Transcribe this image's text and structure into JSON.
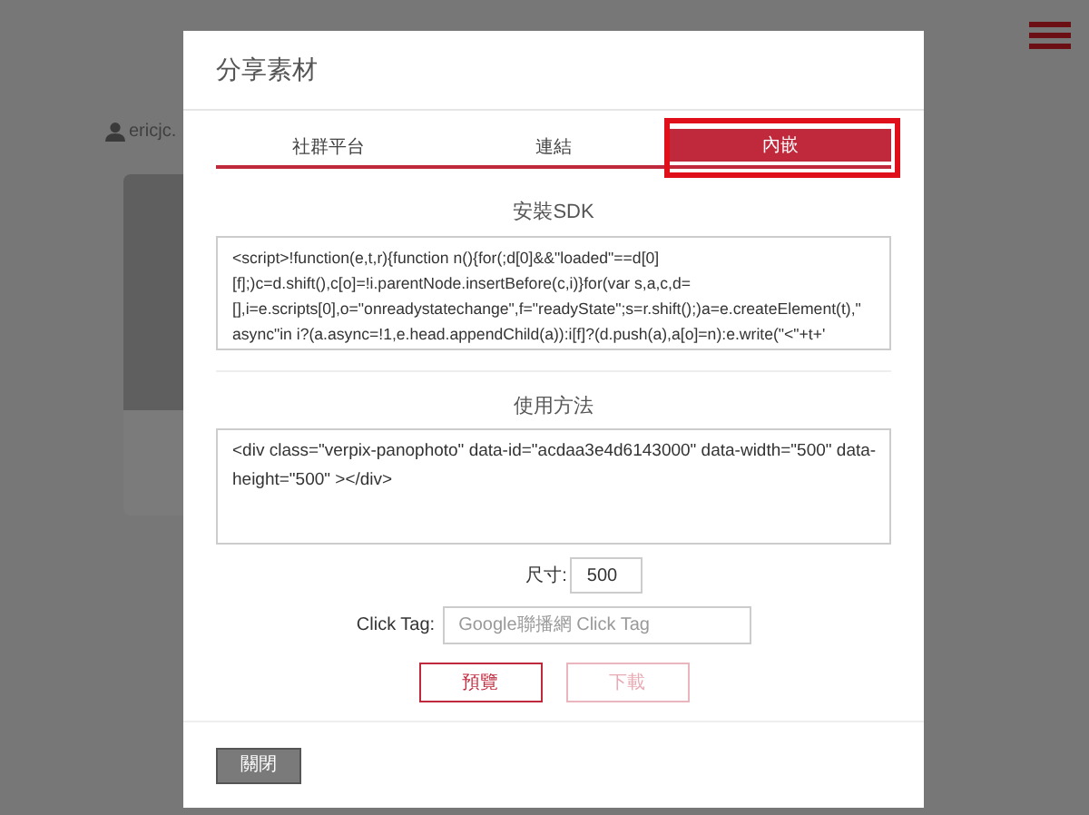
{
  "page": {
    "username": "ericjc."
  },
  "dialog": {
    "title": "分享素材",
    "tabs": [
      {
        "label": "社群平台",
        "selected": false
      },
      {
        "label": "連結",
        "selected": false
      },
      {
        "label": "內嵌",
        "selected": true
      }
    ],
    "sdk_section": {
      "heading": "安裝SDK",
      "code": "<script>!function(e,t,r){function n(){for(;d[0]&&\"loaded\"==d[0]\n[f];)c=d.shift(),c[o]=!i.parentNode.insertBefore(c,i)}for(var s,a,c,d=\n[],i=e.scripts[0],o=\"onreadystatechange\",f=\"readyState\";s=r.shift();)a=e.createElement(t),\"\nasync\"in i?(a.async=!1,e.head.appendChild(a)):i[f]?(d.push(a),a[o]=n):e.write(\"<\"+t+'"
    },
    "usage_section": {
      "heading": "使用方法",
      "code": "<div class=\"verpix-panophoto\" data-id=\"acdaa3e4d6143000\" data-width=\"500\" data-\nheight=\"500\" ></div>"
    },
    "size": {
      "label": "尺寸:",
      "value": "500"
    },
    "click_tag": {
      "label": "Click Tag:",
      "placeholder": "Google聯播網 Click Tag"
    },
    "buttons": [
      {
        "label": "預覽",
        "disabled": false
      },
      {
        "label": "下載",
        "disabled": true
      }
    ],
    "close_button": "關閉"
  }
}
